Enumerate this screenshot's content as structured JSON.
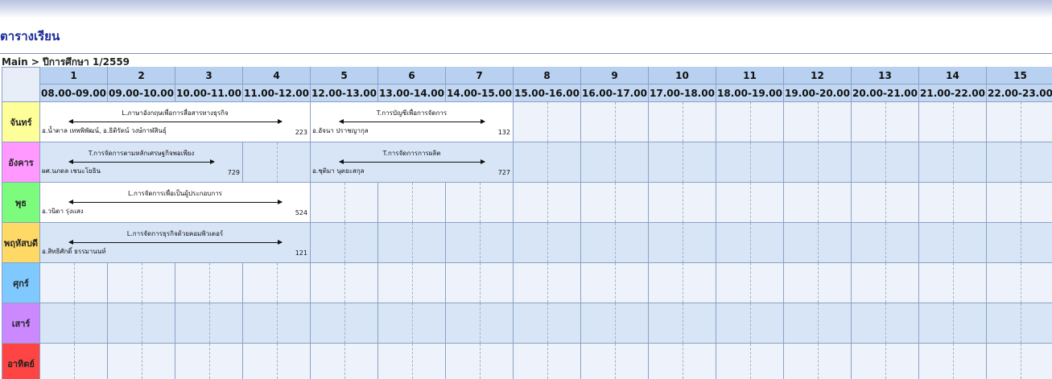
{
  "page": {
    "title": "ตารางเรียน",
    "breadcrumb": "Main > ปีการศึกษา 1/2559"
  },
  "periods": [
    {
      "num": "1",
      "time": "08.00-09.00"
    },
    {
      "num": "2",
      "time": "09.00-10.00"
    },
    {
      "num": "3",
      "time": "10.00-11.00"
    },
    {
      "num": "4",
      "time": "11.00-12.00"
    },
    {
      "num": "5",
      "time": "12.00-13.00"
    },
    {
      "num": "6",
      "time": "13.00-14.00"
    },
    {
      "num": "7",
      "time": "14.00-15.00"
    },
    {
      "num": "8",
      "time": "15.00-16.00"
    },
    {
      "num": "9",
      "time": "16.00-17.00"
    },
    {
      "num": "10",
      "time": "17.00-18.00"
    },
    {
      "num": "11",
      "time": "18.00-19.00"
    },
    {
      "num": "12",
      "time": "19.00-20.00"
    },
    {
      "num": "13",
      "time": "20.00-21.00"
    },
    {
      "num": "14",
      "time": "21.00-22.00"
    },
    {
      "num": "15",
      "time": "22.00-23.00"
    }
  ],
  "days": [
    {
      "label": "จันทร์",
      "color": "#ffff99"
    },
    {
      "label": "อังคาร",
      "color": "#ff99ff"
    },
    {
      "label": "พุธ",
      "color": "#7dfb7d"
    },
    {
      "label": "พฤหัสบดี",
      "color": "#ffd966"
    },
    {
      "label": "ศุกร์",
      "color": "#7fc9ff"
    },
    {
      "label": "เสาร์",
      "color": "#cc88ff"
    },
    {
      "label": "อาทิตย์",
      "color": "#ff4444"
    }
  ],
  "courses": [
    {
      "day": 0,
      "start": 0,
      "span": 4,
      "name": "L.ภาษาอังกฤษเพื่อการสื่อสารทางธุรกิจ",
      "teacher": "อ.น้ำตาล เทพพิพัฒน์, อ.ธิติรัตน์ วงษ์กาฬสินธุ์",
      "room": "223"
    },
    {
      "day": 0,
      "start": 4,
      "span": 3,
      "name": "T.การบัญชีเพื่อการจัดการ",
      "teacher": "อ.อัจนา ปราชญากุล",
      "room": "132"
    },
    {
      "day": 1,
      "start": 0,
      "span": 3,
      "name": "T.การจัดการตามหลักเศรษฐกิจพอเพียง",
      "teacher": "ผศ.นภดล เชนะโยธิน",
      "room": "729"
    },
    {
      "day": 1,
      "start": 4,
      "span": 3,
      "name": "T.การจัดการการผลิต",
      "teacher": "อ.ชุติมา นุตยะสกุล",
      "room": "727"
    },
    {
      "day": 2,
      "start": 0,
      "span": 4,
      "name": "L.การจัดการเพื่อเป็นผู้ประกอบการ",
      "teacher": "อ.วนิดา รุ่งแสง",
      "room": "524"
    },
    {
      "day": 3,
      "start": 0,
      "span": 4,
      "name": "L.การจัดการธุรกิจด้วยคอมพิวเตอร์",
      "teacher": "อ.สิทธิศักดิ์ ธรรมานนท์",
      "room": "121"
    }
  ]
}
